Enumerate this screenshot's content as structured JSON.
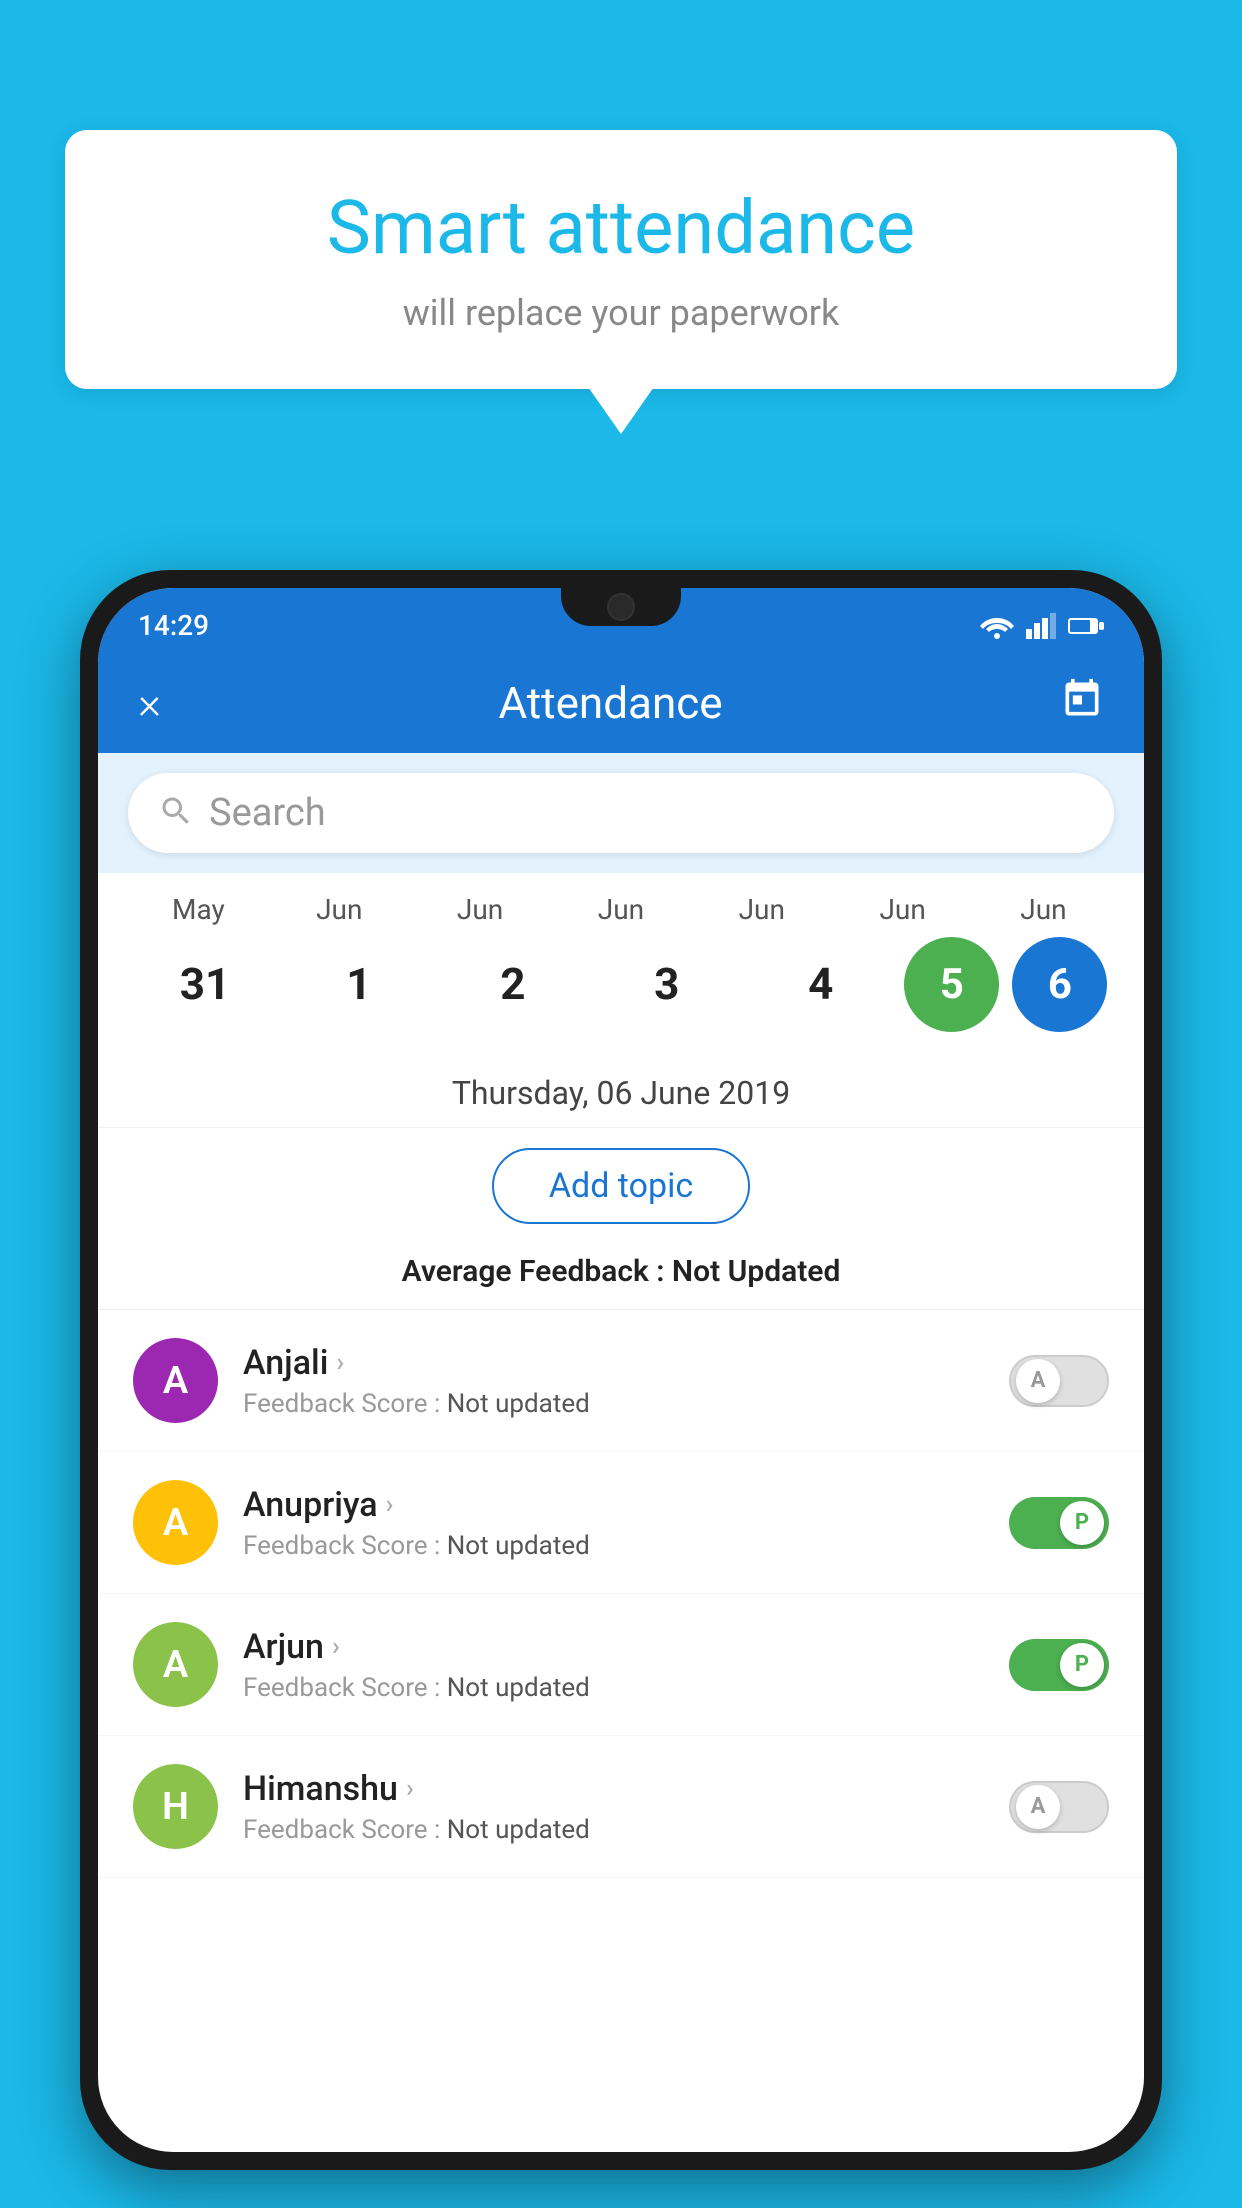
{
  "background_color": "#1BB8E8",
  "bubble": {
    "title": "Smart attendance",
    "subtitle": "will replace your paperwork"
  },
  "status_bar": {
    "time": "14:29",
    "wifi_icon": "wifi",
    "signal_icon": "signal",
    "battery_icon": "battery"
  },
  "header": {
    "title": "Attendance",
    "close_label": "×",
    "calendar_icon": "calendar"
  },
  "search": {
    "placeholder": "Search"
  },
  "calendar": {
    "months": [
      "May",
      "Jun",
      "Jun",
      "Jun",
      "Jun",
      "Jun",
      "Jun"
    ],
    "days": [
      "31",
      "1",
      "2",
      "3",
      "4",
      "5",
      "6"
    ],
    "active_green_index": 5,
    "active_blue_index": 6
  },
  "date_label": "Thursday, 06 June 2019",
  "add_topic_label": "Add topic",
  "avg_feedback_label": "Average Feedback :",
  "avg_feedback_value": "Not Updated",
  "students": [
    {
      "name": "Anjali",
      "avatar_letter": "A",
      "avatar_color": "#9C27B0",
      "feedback_label": "Feedback Score :",
      "feedback_value": "Not updated",
      "toggle_state": "off",
      "toggle_letter": "A"
    },
    {
      "name": "Anupriya",
      "avatar_letter": "A",
      "avatar_color": "#FFC107",
      "feedback_label": "Feedback Score :",
      "feedback_value": "Not updated",
      "toggle_state": "on",
      "toggle_letter": "P"
    },
    {
      "name": "Arjun",
      "avatar_letter": "A",
      "avatar_color": "#8BC34A",
      "feedback_label": "Feedback Score :",
      "feedback_value": "Not updated",
      "toggle_state": "on",
      "toggle_letter": "P"
    },
    {
      "name": "Himanshu",
      "avatar_letter": "H",
      "avatar_color": "#8BC34A",
      "feedback_label": "Feedback Score :",
      "feedback_value": "Not updated",
      "toggle_state": "off",
      "toggle_letter": "A"
    }
  ]
}
